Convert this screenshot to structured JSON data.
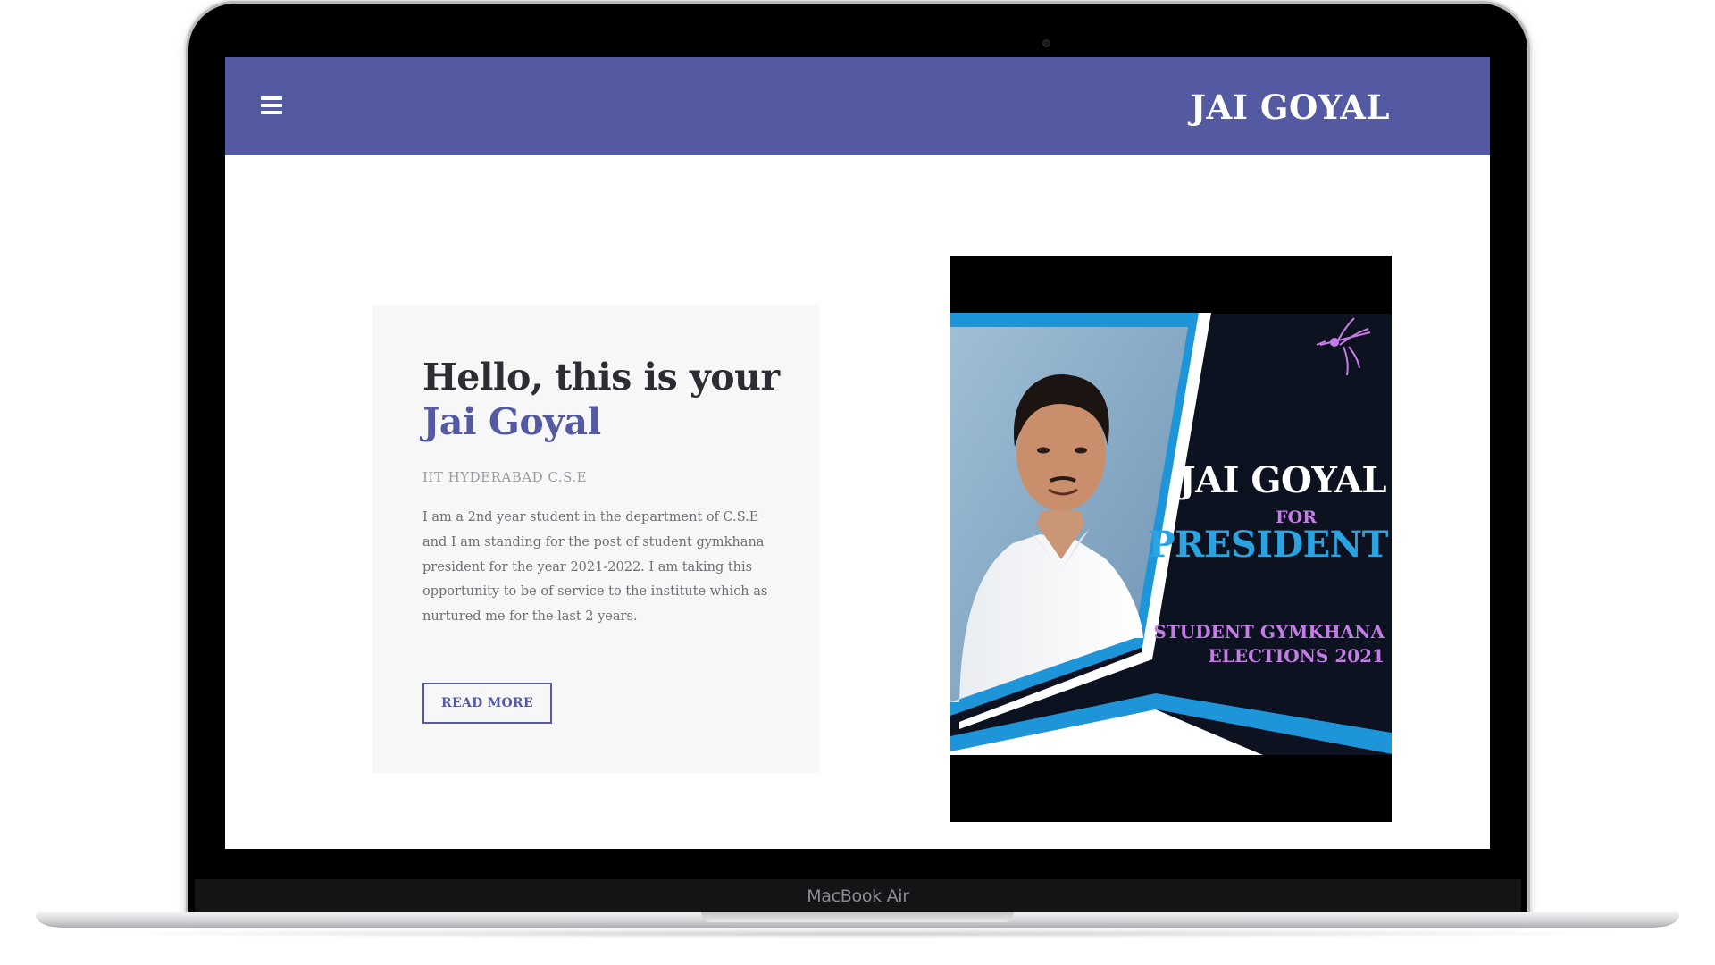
{
  "device": {
    "label": "MacBook Air"
  },
  "navbar": {
    "title": "JAI GOYAL",
    "menu_icon": "hamburger-menu-icon",
    "background": "#535aa2"
  },
  "intro": {
    "heading_line1": "Hello, this is your",
    "heading_name": "Jai Goyal",
    "subtitle": "IIT HYDERABAD C.S.E",
    "description": "I am a 2nd year student in the department of C.S.E and I am standing for the post of student gymkhana president for the year 2021-2022. I am taking this opportunity to be of service to the institute which as nurtured me for the last 2 years.",
    "button_label": "READ MORE",
    "accent_color": "#535aa2"
  },
  "poster": {
    "name": "JAI GOYAL",
    "for": "FOR",
    "role": "PRESIDENT",
    "event_line1": "STUDENT GYMKHANA",
    "event_line2": "ELECTIONS 2021",
    "logo_icon": "hummingbird-logo-icon",
    "colors": {
      "background": "#0d1220",
      "blue": "#1e95d8",
      "purple": "#c67ce6"
    }
  }
}
